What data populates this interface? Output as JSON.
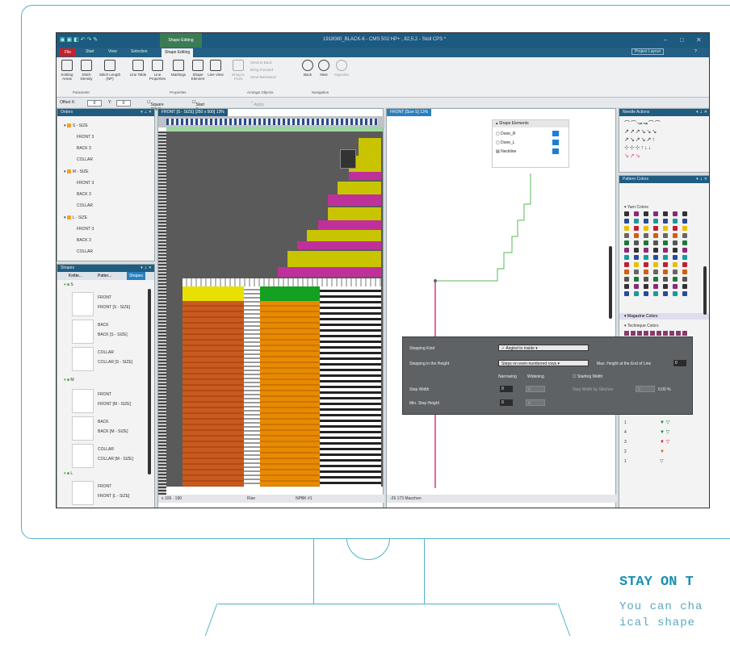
{
  "app": {
    "window_title": "1918080_BLACK-6 - CMS 502 HP+ , 82,5.2 - Stoll CPS *",
    "context_tab": "Shape Editing"
  },
  "ribbon": {
    "tabs": [
      "File",
      "Start",
      "View",
      "Selection",
      "Shape Editing"
    ],
    "buttons": [
      {
        "label": "Knitting Areas",
        "icon": "knitting-areas-icon"
      },
      {
        "label": "Stitch Density",
        "icon": "stitch-density-icon"
      },
      {
        "label": "Stitch Length (NP)",
        "icon": "stitch-length-icon"
      },
      {
        "label": "Line Table",
        "icon": "line-table-icon"
      },
      {
        "label": "Line Properties",
        "icon": "line-properties-icon"
      },
      {
        "label": "Markings",
        "icon": "markings-icon"
      },
      {
        "label": "Shape Element",
        "icon": "shape-element-icon"
      },
      {
        "label": "Line View",
        "icon": "line-view-icon"
      },
      {
        "label": "Bring to Front",
        "icon": "bring-to-front-icon"
      }
    ],
    "arrange": {
      "send_to_back": "Send to Back",
      "bring_forward": "Bring Forward",
      "send_backward": "Send Backward"
    },
    "nav": {
      "back": "Back",
      "next": "Next",
      "opposite": "Opposite"
    },
    "groups": {
      "parameter": "Parameter",
      "properties": "Properties",
      "arrange": "Arrange Objects",
      "navigation": "Navigation"
    },
    "project_layout": "Project Layout"
  },
  "optbar": {
    "offset_x_label": "Offset X:",
    "offset_x": "0",
    "y_label": "Y:",
    "y": "0",
    "square": "Square (Shift)",
    "start_center": "Start From Center",
    "apply": "Apply"
  },
  "orders": {
    "title": "Orders",
    "sizes": [
      {
        "label": "S - SIZE",
        "items": [
          {
            "label": "FRONT",
            "count": "3"
          },
          {
            "label": "BACK",
            "count": "3"
          },
          {
            "label": "COLLAR",
            "count": ""
          }
        ]
      },
      {
        "label": "M - SIZE",
        "items": [
          {
            "label": "FRONT",
            "count": "3"
          },
          {
            "label": "BACK",
            "count": "3"
          },
          {
            "label": "COLLAR",
            "count": ""
          }
        ]
      },
      {
        "label": "L - SIZE",
        "items": [
          {
            "label": "FRONT",
            "count": "3"
          },
          {
            "label": "BACK",
            "count": "3"
          },
          {
            "label": "COLLAR",
            "count": ""
          }
        ]
      }
    ]
  },
  "shapes": {
    "title": "Shapes",
    "tabs": [
      "Knitte...",
      "Patter...",
      "Shapes"
    ],
    "groups": [
      {
        "label": "S",
        "items": [
          {
            "title": "FRONT",
            "sub": "FRONT [S - SIZE]"
          },
          {
            "title": "BACK",
            "sub": "BACK [S - SIZE]"
          },
          {
            "title": "COLLAR",
            "sub": "COLLAR [S - SIZE]"
          }
        ]
      },
      {
        "label": "M",
        "items": [
          {
            "title": "FRONT",
            "sub": "FRONT [M - SIZE]"
          },
          {
            "title": "BACK",
            "sub": "BACK [M - SIZE]"
          },
          {
            "title": "COLLAR",
            "sub": "COLLAR [M - SIZE]"
          }
        ]
      },
      {
        "label": "L",
        "items": [
          {
            "title": "FRONT",
            "sub": "FRONT [L - SIZE]"
          }
        ]
      }
    ]
  },
  "doc_left": {
    "tab": "FRONT [S - SIZE] [350 x 500] 13%",
    "status_coords": "x 106 · 190",
    "status_mid": "Rise",
    "status_npbk": "NPBK #1"
  },
  "doc_right": {
    "tab": "FRONT [Size S] 13%",
    "status_coords": "-26  173  Maschen"
  },
  "shape_elements": {
    "title": "Shape Elements",
    "items": [
      "Done_R",
      "Done_L",
      "Neckline"
    ]
  },
  "needle_actions": {
    "title": "Needle Actions"
  },
  "pattern_colors": {
    "title": "Pattern Colors",
    "yarn_colors": "Yarn Colors",
    "magazine_colors": "Magazine Colors",
    "technique_colors": "Technique Colors",
    "rows": [
      "1",
      "4",
      "3",
      "2",
      "1"
    ]
  },
  "dialog": {
    "stepping_kind_label": "Stepping Kind",
    "stepping_kind_value": "Angled to inside",
    "stepping_height_label": "Stepping in the Height",
    "stepping_height_value": "Steps on even-numbered rows",
    "max_height_label": "Max. Height at the End of Line",
    "max_height_value": "0",
    "narrowing": "Narrowing",
    "widening": "Widening",
    "starting_width": "Starting Width",
    "step_width_label": "Step Width",
    "step_width_value": "0",
    "step_width_widen": "0",
    "min_step_label": "Min. Step Height",
    "min_step_value": "0",
    "min_step_widen": "0",
    "step_width_by_stitches": "Step Width by Stitches",
    "stitches_value": "0",
    "percent": "0.00 %"
  },
  "promo": {
    "title": "STAY ON T",
    "text": "You can cha\nical shape"
  },
  "colors": {
    "accent": "#4fb2c8",
    "title_bar": "#1c5a80",
    "knit_orange": "#e07a00",
    "knit_rust": "#c85a1e",
    "knit_yellow": "#e8e000",
    "knit_green": "#14a020",
    "knit_magenta": "#c0309a",
    "shape_line_green": "#55bb55",
    "shape_line_pink": "#e0407a"
  }
}
